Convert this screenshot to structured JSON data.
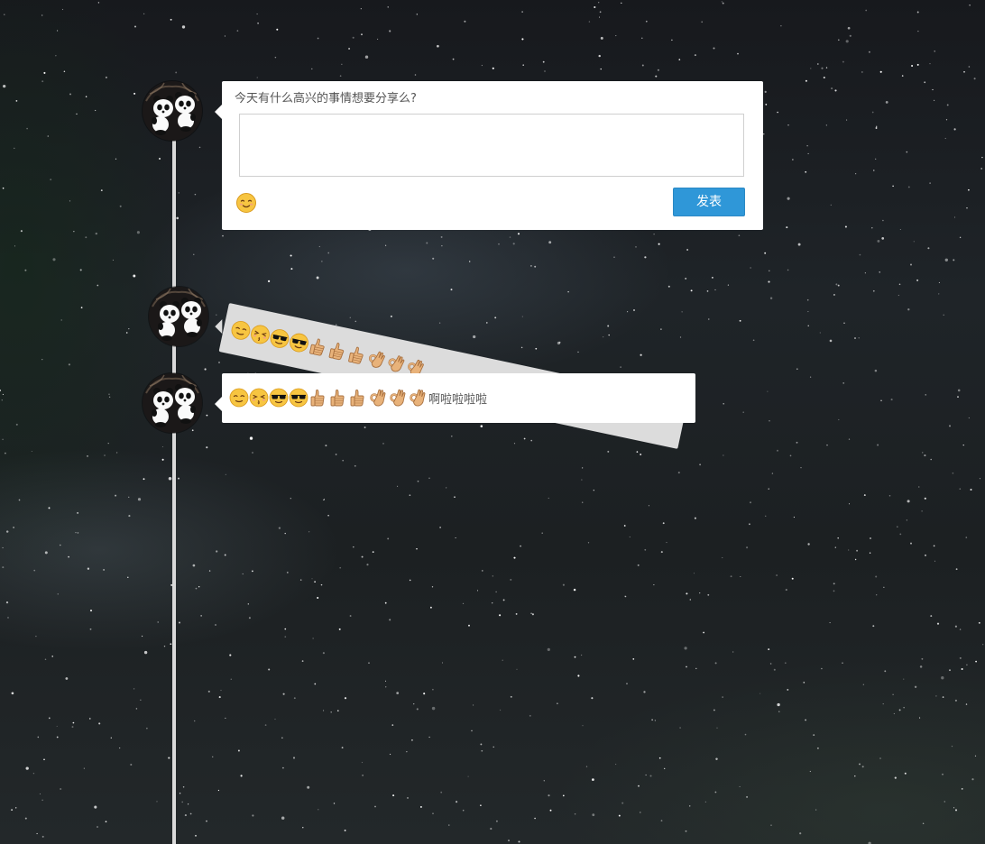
{
  "composer": {
    "prompt": "今天有什么高兴的事情想要分享么?",
    "input_value": "",
    "emoji_button_icon": "smiling-face-icon",
    "submit_label": "发表"
  },
  "posts": [
    {
      "state": "animating",
      "emojis": [
        "relieved-face",
        "kissing-closed-eyes-face",
        "sunglasses-face",
        "sunglasses-face",
        "thumbs-up",
        "thumbs-up",
        "thumbs-up",
        "ok-hand",
        "ok-hand",
        "ok-hand"
      ],
      "text": ""
    },
    {
      "state": "posted",
      "emojis": [
        "relieved-face",
        "kissing-closed-eyes-face",
        "sunglasses-face",
        "sunglasses-face",
        "thumbs-up",
        "thumbs-up",
        "thumbs-up",
        "ok-hand",
        "ok-hand",
        "ok-hand"
      ],
      "text": "啊啦啦啦啦"
    }
  ],
  "colors": {
    "accent_button": "#2f97d8",
    "timeline_line": "#d9d9d9",
    "card_background": "#ffffff"
  }
}
